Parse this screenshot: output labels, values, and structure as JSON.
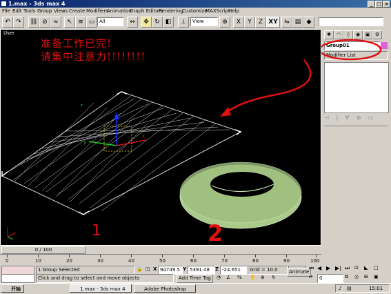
{
  "window": {
    "title": "1.max - 3ds max 4"
  },
  "menu": [
    "File",
    "Edit",
    "Tools",
    "Group",
    "Views",
    "Create",
    "Modifiers",
    "Animation",
    "Graph Editors",
    "Rendering",
    "Customize",
    "MAXScript",
    "Help"
  ],
  "toolbar": {
    "selection_filter": "All",
    "coord_system": "View",
    "axis_constraint": "XY"
  },
  "viewport": {
    "label": "User",
    "note_line1": "准备工作已完!",
    "note_line2": "请集中注意力!!!!!!!!",
    "marker_1": "1",
    "marker_2": "2"
  },
  "command_panel": {
    "object_name": "Group01",
    "modifier_list": "Modifier List",
    "name_color": "#e060e0"
  },
  "timeline": {
    "frame_readout": "0 / 100",
    "ticks": [
      "0",
      "10",
      "20",
      "30",
      "40",
      "50",
      "60",
      "70",
      "80",
      "90",
      "100"
    ]
  },
  "status": {
    "selection": "1 Group Selected",
    "prompt": "Click and drag to select and move objects",
    "x_label": "X",
    "x_value": "94749.5",
    "y_label": "Y",
    "y_value": "5391.48",
    "z_label": "Z",
    "z_value": "-24.651",
    "grid": "Grid = 10.0",
    "add_time_tag": "Add Time Tag",
    "animate": "Animate",
    "current_frame": "0"
  },
  "taskbar": {
    "start": "开始",
    "task1": "1.max - 3ds max 4",
    "task2": "Adobe Photoshop",
    "clock": "15:01"
  },
  "colors": {
    "annotation_red": "#e01010",
    "grid_white": "#d8d8d8",
    "torus_green": "#a9c98a"
  }
}
